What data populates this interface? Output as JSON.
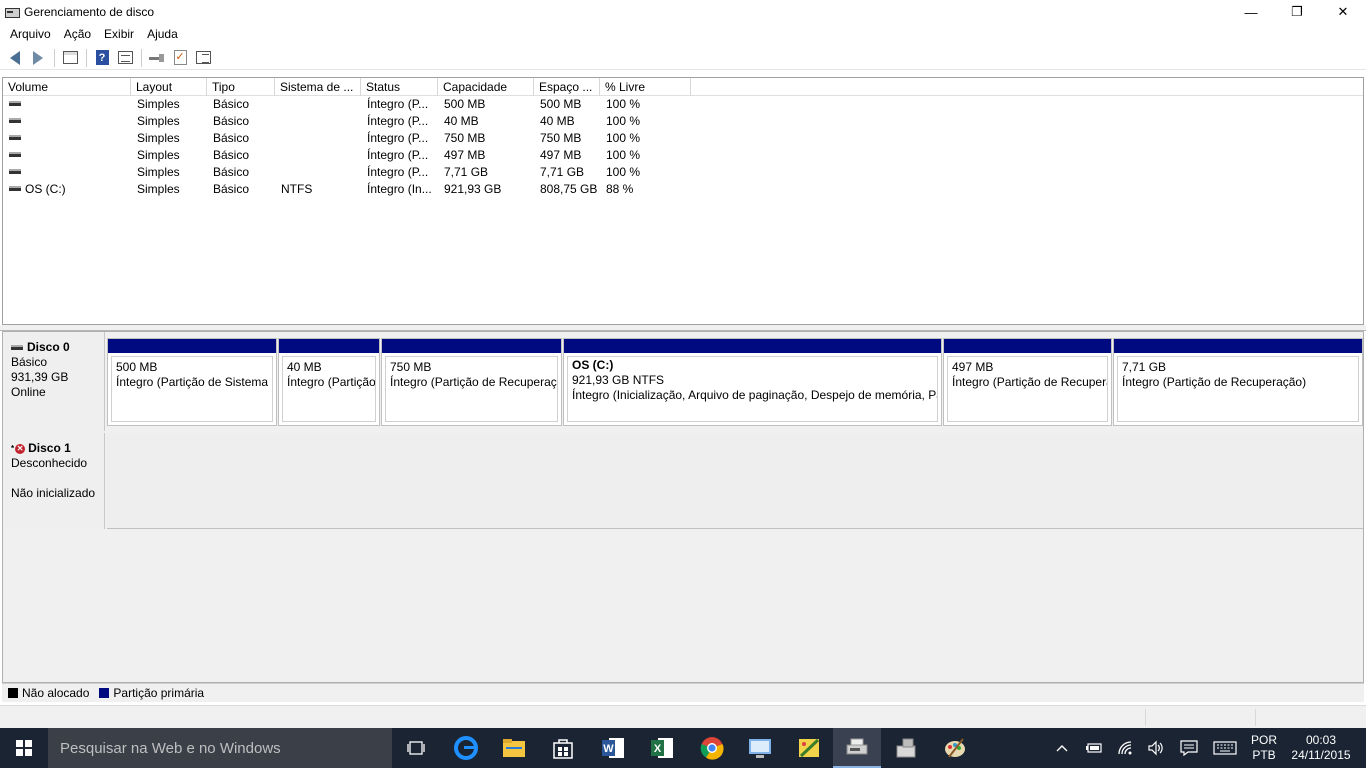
{
  "window": {
    "title": "Gerenciamento de disco",
    "minimize": "—",
    "maximize": "❐",
    "close": "✕"
  },
  "menu": [
    "Arquivo",
    "Ação",
    "Exibir",
    "Ajuda"
  ],
  "toolbar": {
    "icons": [
      "back-arrow-icon",
      "forward-arrow-icon",
      "console-tree-icon",
      "help-icon",
      "properties-icon",
      "rescan-icon",
      "check-icon",
      "list-view-icon"
    ]
  },
  "volume_list": {
    "columns": [
      "Volume",
      "Layout",
      "Tipo",
      "Sistema de ...",
      "Status",
      "Capacidade",
      "Espaço ...",
      "% Livre"
    ],
    "rows": [
      [
        "",
        "Simples",
        "Básico",
        "",
        "Íntegro (P...",
        "500 MB",
        "500 MB",
        "100 %"
      ],
      [
        "",
        "Simples",
        "Básico",
        "",
        "Íntegro (P...",
        "40 MB",
        "40 MB",
        "100 %"
      ],
      [
        "",
        "Simples",
        "Básico",
        "",
        "Íntegro (P...",
        "750 MB",
        "750 MB",
        "100 %"
      ],
      [
        "",
        "Simples",
        "Básico",
        "",
        "Íntegro (P...",
        "497 MB",
        "497 MB",
        "100 %"
      ],
      [
        "",
        "Simples",
        "Básico",
        "",
        "Íntegro (P...",
        "7,71 GB",
        "7,71 GB",
        "100 %"
      ],
      [
        "OS (C:)",
        "Simples",
        "Básico",
        "NTFS",
        "Íntegro (In...",
        "921,93 GB",
        "808,75 GB",
        "88 %"
      ]
    ]
  },
  "disks": [
    {
      "name": "Disco 0",
      "type": "Básico",
      "size": "931,39 GB",
      "state": "Online",
      "partitions": [
        {
          "name": "",
          "size": "500 MB",
          "status": "Íntegro (Partição de Sistema EFI)"
        },
        {
          "name": "",
          "size": "40 MB",
          "status": "Íntegro (Partição OEM)"
        },
        {
          "name": "",
          "size": "750 MB",
          "status": "Íntegro (Partição de Recuperação)"
        },
        {
          "name": "OS  (C:)",
          "size": "921,93 GB NTFS",
          "status": "Íntegro (Inicialização, Arquivo de paginação, Despejo de memória, Partição primária)"
        },
        {
          "name": "",
          "size": "497 MB",
          "status": "Íntegro (Partição de Recuperação)"
        },
        {
          "name": "",
          "size": "7,71 GB",
          "status": "Íntegro (Partição de Recuperação)"
        }
      ]
    },
    {
      "name": "Disco 1",
      "type": "Desconhecido",
      "size": "",
      "state": "Não inicializado"
    }
  ],
  "legend": [
    {
      "label": "Não alocado",
      "color": "#000000"
    },
    {
      "label": "Partição primária",
      "color": "#000a80"
    }
  ],
  "taskbar": {
    "search_placeholder": "Pesquisar na Web e no Windows",
    "language_line1": "POR",
    "language_line2": "PTB",
    "time": "00:03",
    "date": "24/11/2015"
  },
  "colors": {
    "partition_bar": "#000a80",
    "taskbar": "#1a2433"
  }
}
